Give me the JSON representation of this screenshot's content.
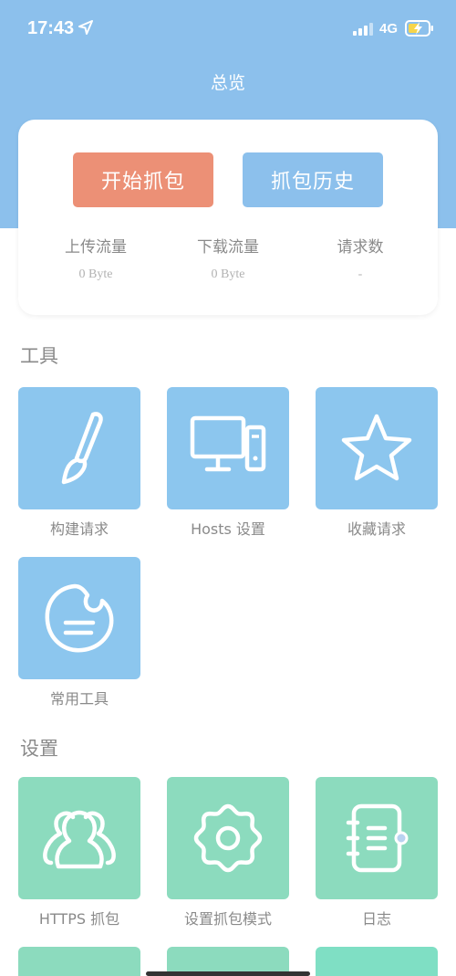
{
  "status_bar": {
    "time": "17:43",
    "network": "4G",
    "icons": [
      "location-arrow-icon",
      "signal-bars-icon",
      "battery-charging-icon"
    ]
  },
  "nav": {
    "title": "总览"
  },
  "summary": {
    "start_button": "开始抓包",
    "history_button": "抓包历史",
    "stats": [
      {
        "label": "上传流量",
        "value": "0 Byte"
      },
      {
        "label": "下载流量",
        "value": "0 Byte"
      },
      {
        "label": "请求数",
        "value": "-"
      }
    ]
  },
  "sections": {
    "tools": {
      "title": "工具",
      "items": [
        {
          "label": "构建请求",
          "icon": "paintbrush-icon"
        },
        {
          "label": "Hosts 设置",
          "icon": "computer-icon"
        },
        {
          "label": "收藏请求",
          "icon": "star-icon"
        },
        {
          "label": "常用工具",
          "icon": "chat-bubble-icon"
        }
      ]
    },
    "settings": {
      "title": "设置",
      "items": [
        {
          "label": "HTTPS 抓包",
          "icon": "users-icon"
        },
        {
          "label": "设置抓包模式",
          "icon": "gear-icon"
        },
        {
          "label": "日志",
          "icon": "notebook-icon"
        }
      ]
    }
  },
  "colors": {
    "header_blue": "#8cc0ec",
    "start_orange": "#ec9076",
    "tile_blue": "#8cc6ee",
    "tile_green": "#8cdbbe"
  }
}
